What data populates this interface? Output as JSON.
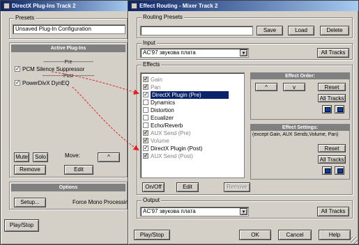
{
  "left_window": {
    "title": "DirectX Plug-Ins Track 2",
    "presets_label": "Presets",
    "preset_value": "Unsaved Plug-In Configuration",
    "active_header": "Active Plug-Ins",
    "pre_label": "-------------Pre-------------",
    "post_label": "-------------Post-------------",
    "items": [
      {
        "label": "PCM Silence Suppressor",
        "checked": true
      },
      {
        "label": "PowerDivX DynEQ",
        "checked": true
      }
    ],
    "mute_label": "Mute",
    "solo_label": "Solo",
    "move_label": "Move:",
    "up_arrow": "^",
    "remove_label": "Remove",
    "edit_label": "Edit",
    "options_header": "Options",
    "setup_label": "Setup...",
    "force_mono_label": "Force Mono Processing",
    "play_stop_label": "Play/Stop"
  },
  "right_window": {
    "title": "Effect Routing - Mixer Track 2",
    "routing_presets_label": "Routing Presets",
    "save_label": "Save",
    "load_label": "Load",
    "delete_label": "Delete",
    "input_label": "Input",
    "input_value": "AC'97 звукова плата",
    "all_tracks_label": "All Tracks",
    "effects_label": "Effects",
    "effects": [
      {
        "label": "Gain",
        "checked": true,
        "gray": true
      },
      {
        "label": "Pan",
        "checked": true,
        "gray": true
      },
      {
        "label": "DirectX Plugin (Pre)",
        "checked": true,
        "selected": true
      },
      {
        "label": "Dynamics",
        "checked": false
      },
      {
        "label": "Distortion",
        "checked": false
      },
      {
        "label": "Ecualizer",
        "checked": false
      },
      {
        "label": "Echo/Reverb",
        "checked": false
      },
      {
        "label": "AUX Send (Pre)",
        "checked": true,
        "gray": true
      },
      {
        "label": "Volume",
        "checked": true,
        "gray": true
      },
      {
        "label": "DirectX Plugin (Post)",
        "checked": true
      },
      {
        "label": "AUX Send (Post)",
        "checked": true,
        "gray": true
      }
    ],
    "effect_order_header": "Effect Order:",
    "up_arrow": "^",
    "down_arrow": "v",
    "reset_label": "Reset",
    "all_tracks_short": "All Tracks",
    "effect_settings_header": "Effect Settings:",
    "settings_note": "(except Gain, AUX Sends,Volume, Pan)",
    "onoff_label": "On/Off",
    "edit_label": "Edit",
    "remove_label": "Remove",
    "output_label": "Output",
    "output_value": "AC'97 звукова плата",
    "play_stop_label": "Play/Stop",
    "ok_label": "OK",
    "cancel_label": "Cancel",
    "help_label": "Help"
  },
  "colors": {
    "face": "#d4d0c8",
    "title_start": "#0a246a",
    "title_end": "#a6caf0",
    "selection": "#0a246a",
    "arrow": "#e02020"
  }
}
